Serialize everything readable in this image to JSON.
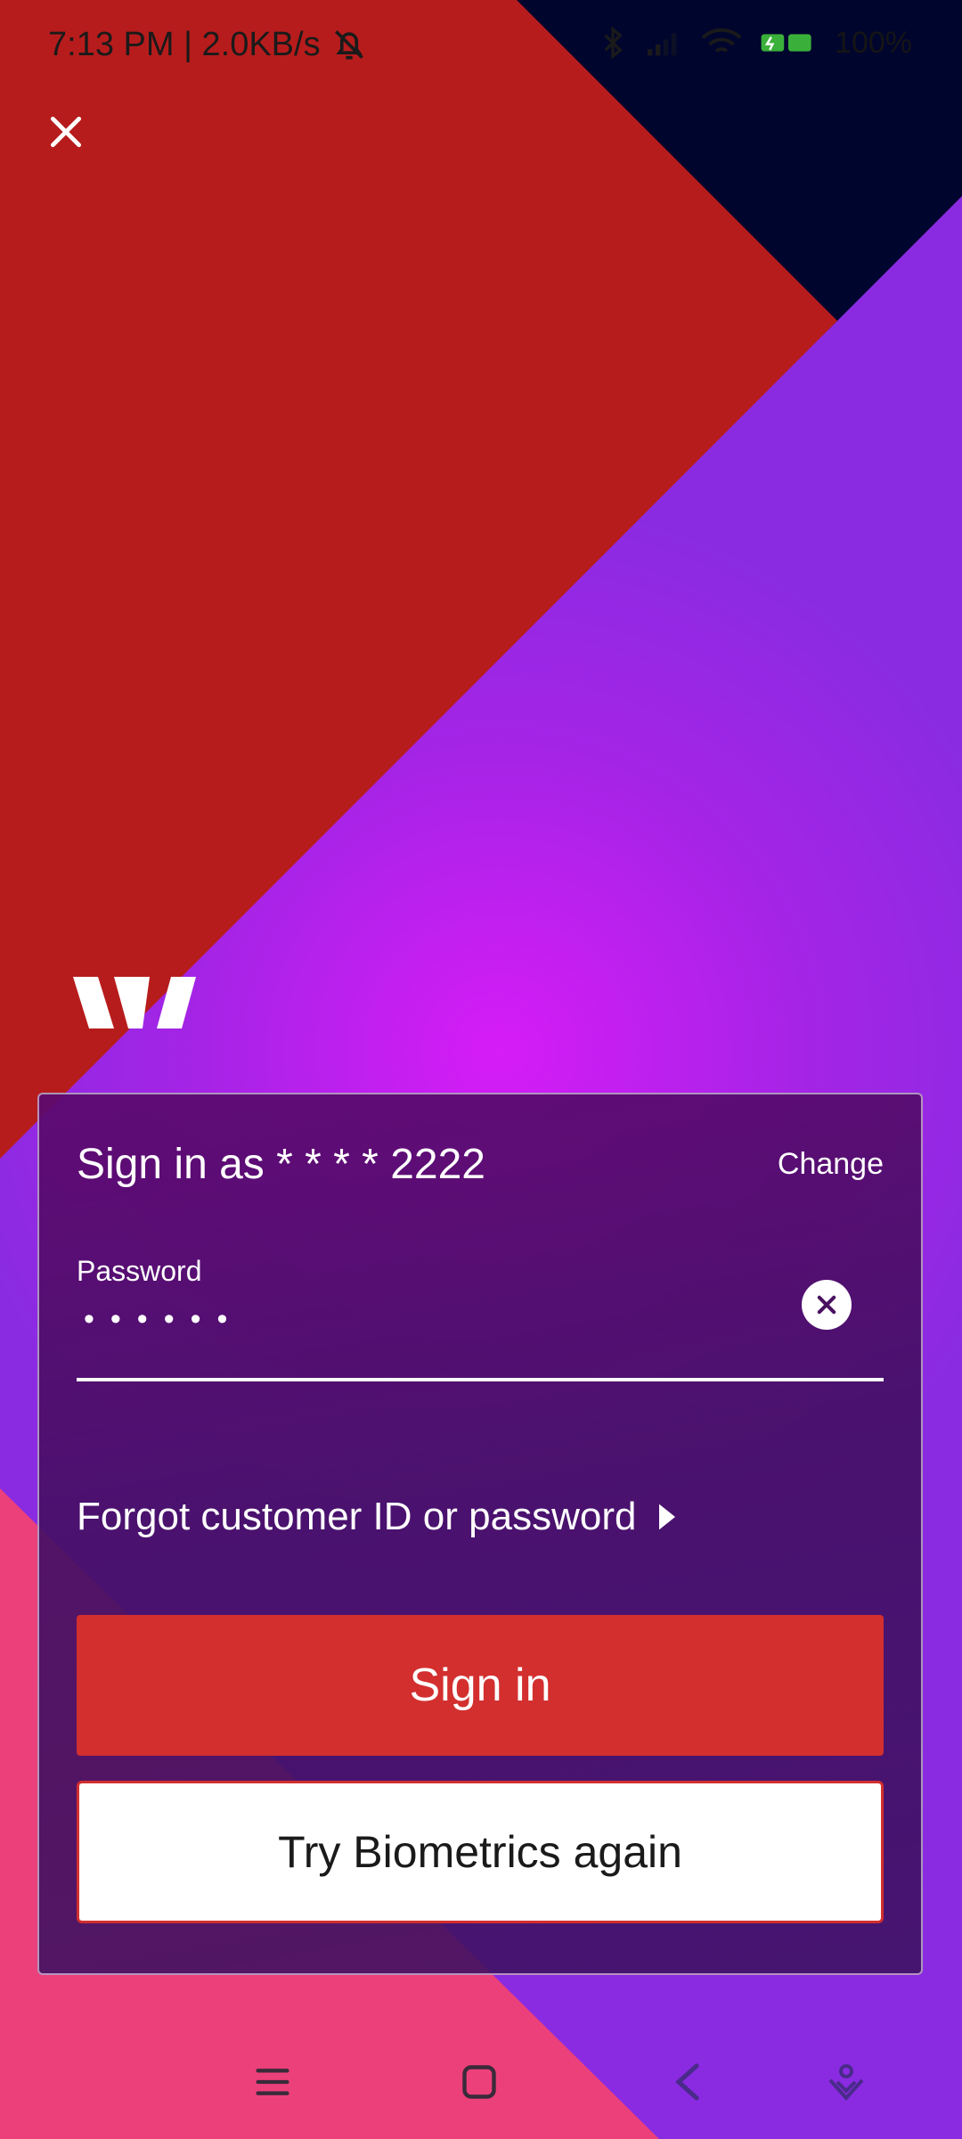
{
  "status_bar": {
    "time_speed": "7:13 PM | 2.0KB/s",
    "battery": "100%",
    "icons": [
      "mute-bell-icon",
      "bluetooth-icon",
      "signal-icon",
      "wifi-icon",
      "battery-icon"
    ]
  },
  "close_icon": "close-icon",
  "colors": {
    "red_panel": "#b71c1c",
    "navy_corner": "#00052e",
    "purple_bg": "#8a2be2",
    "magenta_glow": "#d61cf7",
    "pink_panel": "#ec407a",
    "sign_in_button": "#d32f2f"
  },
  "card": {
    "sign_in_as": "Sign in as * * * * 2222",
    "change_label": "Change",
    "password_label": "Password",
    "password_value": "••••••",
    "clear_icon": "clear-circle-icon",
    "forgot_label": "Forgot customer ID or password",
    "forgot_icon": "caret-right-icon",
    "sign_in_label": "Sign in",
    "biometrics_label": "Try Biometrics again"
  },
  "nav_bar": {
    "icons": [
      "menu-icon",
      "home-square-icon",
      "back-icon",
      "assistant-icon"
    ]
  }
}
